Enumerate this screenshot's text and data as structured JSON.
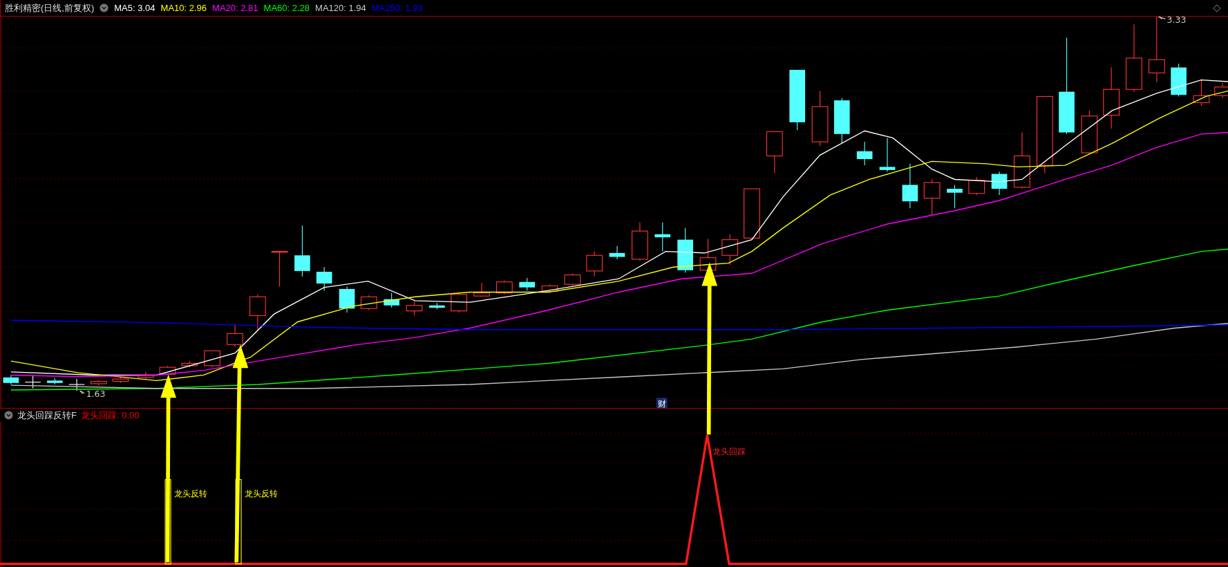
{
  "header": {
    "title": "胜利精密(日线,前复权)",
    "ma": [
      {
        "text": "MA5: 3.04",
        "color": "#ffffff"
      },
      {
        "text": "MA10: 2.96",
        "color": "#ffff00"
      },
      {
        "text": "MA20: 2.81",
        "color": "#ff00ff"
      },
      {
        "text": "MA60: 2.28",
        "color": "#00ff00"
      },
      {
        "text": "MA120: 1.94",
        "color": "#c8c8c8"
      },
      {
        "text": "MA250: 1.93",
        "color": "#0000ff"
      }
    ]
  },
  "price_chart": {
    "high_label": "3.33",
    "low_label": "1.63",
    "event_badge": "财"
  },
  "indicator": {
    "title": "龙头回踩反转F",
    "legend": {
      "text": "龙头回踩: 0.00",
      "color": "#ff0000"
    },
    "signals": [
      {
        "kind": "reversal",
        "label": "龙头反转"
      },
      {
        "kind": "reversal",
        "label": "龙头反转"
      },
      {
        "kind": "pullback",
        "label": "龙头回踩"
      }
    ]
  }
}
